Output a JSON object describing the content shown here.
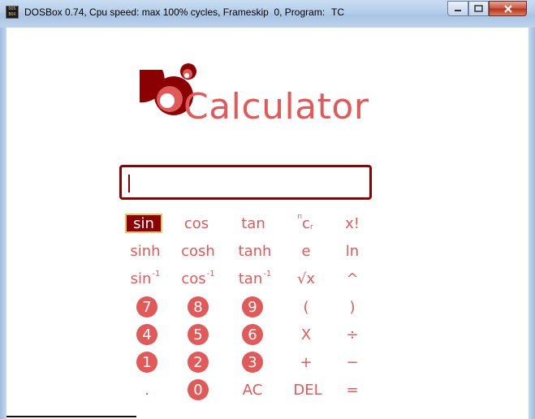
{
  "window": {
    "title": "DOSBox 0.74, Cpu speed: max 100% cycles, Frameskip  0, Program:",
    "program": "TC",
    "icon_text": "DOS BOX",
    "buttons": [
      "minimize",
      "maximize",
      "close"
    ]
  },
  "app": {
    "logo_text": "Calculator",
    "colors": {
      "accent": "#e05a5a",
      "dark_red": "#8b0000",
      "highlight_border": "#f0c060"
    },
    "display": {
      "value": ""
    },
    "keys": {
      "sin": "sin",
      "cos": "cos",
      "tan": "tan",
      "ncr_n": "n",
      "ncr_c": "c",
      "ncr_r": "r",
      "fact": "x!",
      "sinh": "sinh",
      "cosh": "cosh",
      "tanh": "tanh",
      "e": "e",
      "ln": "ln",
      "asin": "sin",
      "acos": "cos",
      "atan": "tan",
      "inv": "-1",
      "sqrt": "√x",
      "pow": "^",
      "n7": "7",
      "n8": "8",
      "n9": "9",
      "lparen": "(",
      "rparen": ")",
      "n4": "4",
      "n5": "5",
      "n6": "6",
      "mul": "X",
      "div": "÷",
      "n1": "1",
      "n2": "2",
      "n3": "3",
      "add": "+",
      "sub": "−",
      "dot": ".",
      "n0": "0",
      "ac": "AC",
      "del": "DEL",
      "eq": "="
    },
    "selected_key": "sin"
  }
}
